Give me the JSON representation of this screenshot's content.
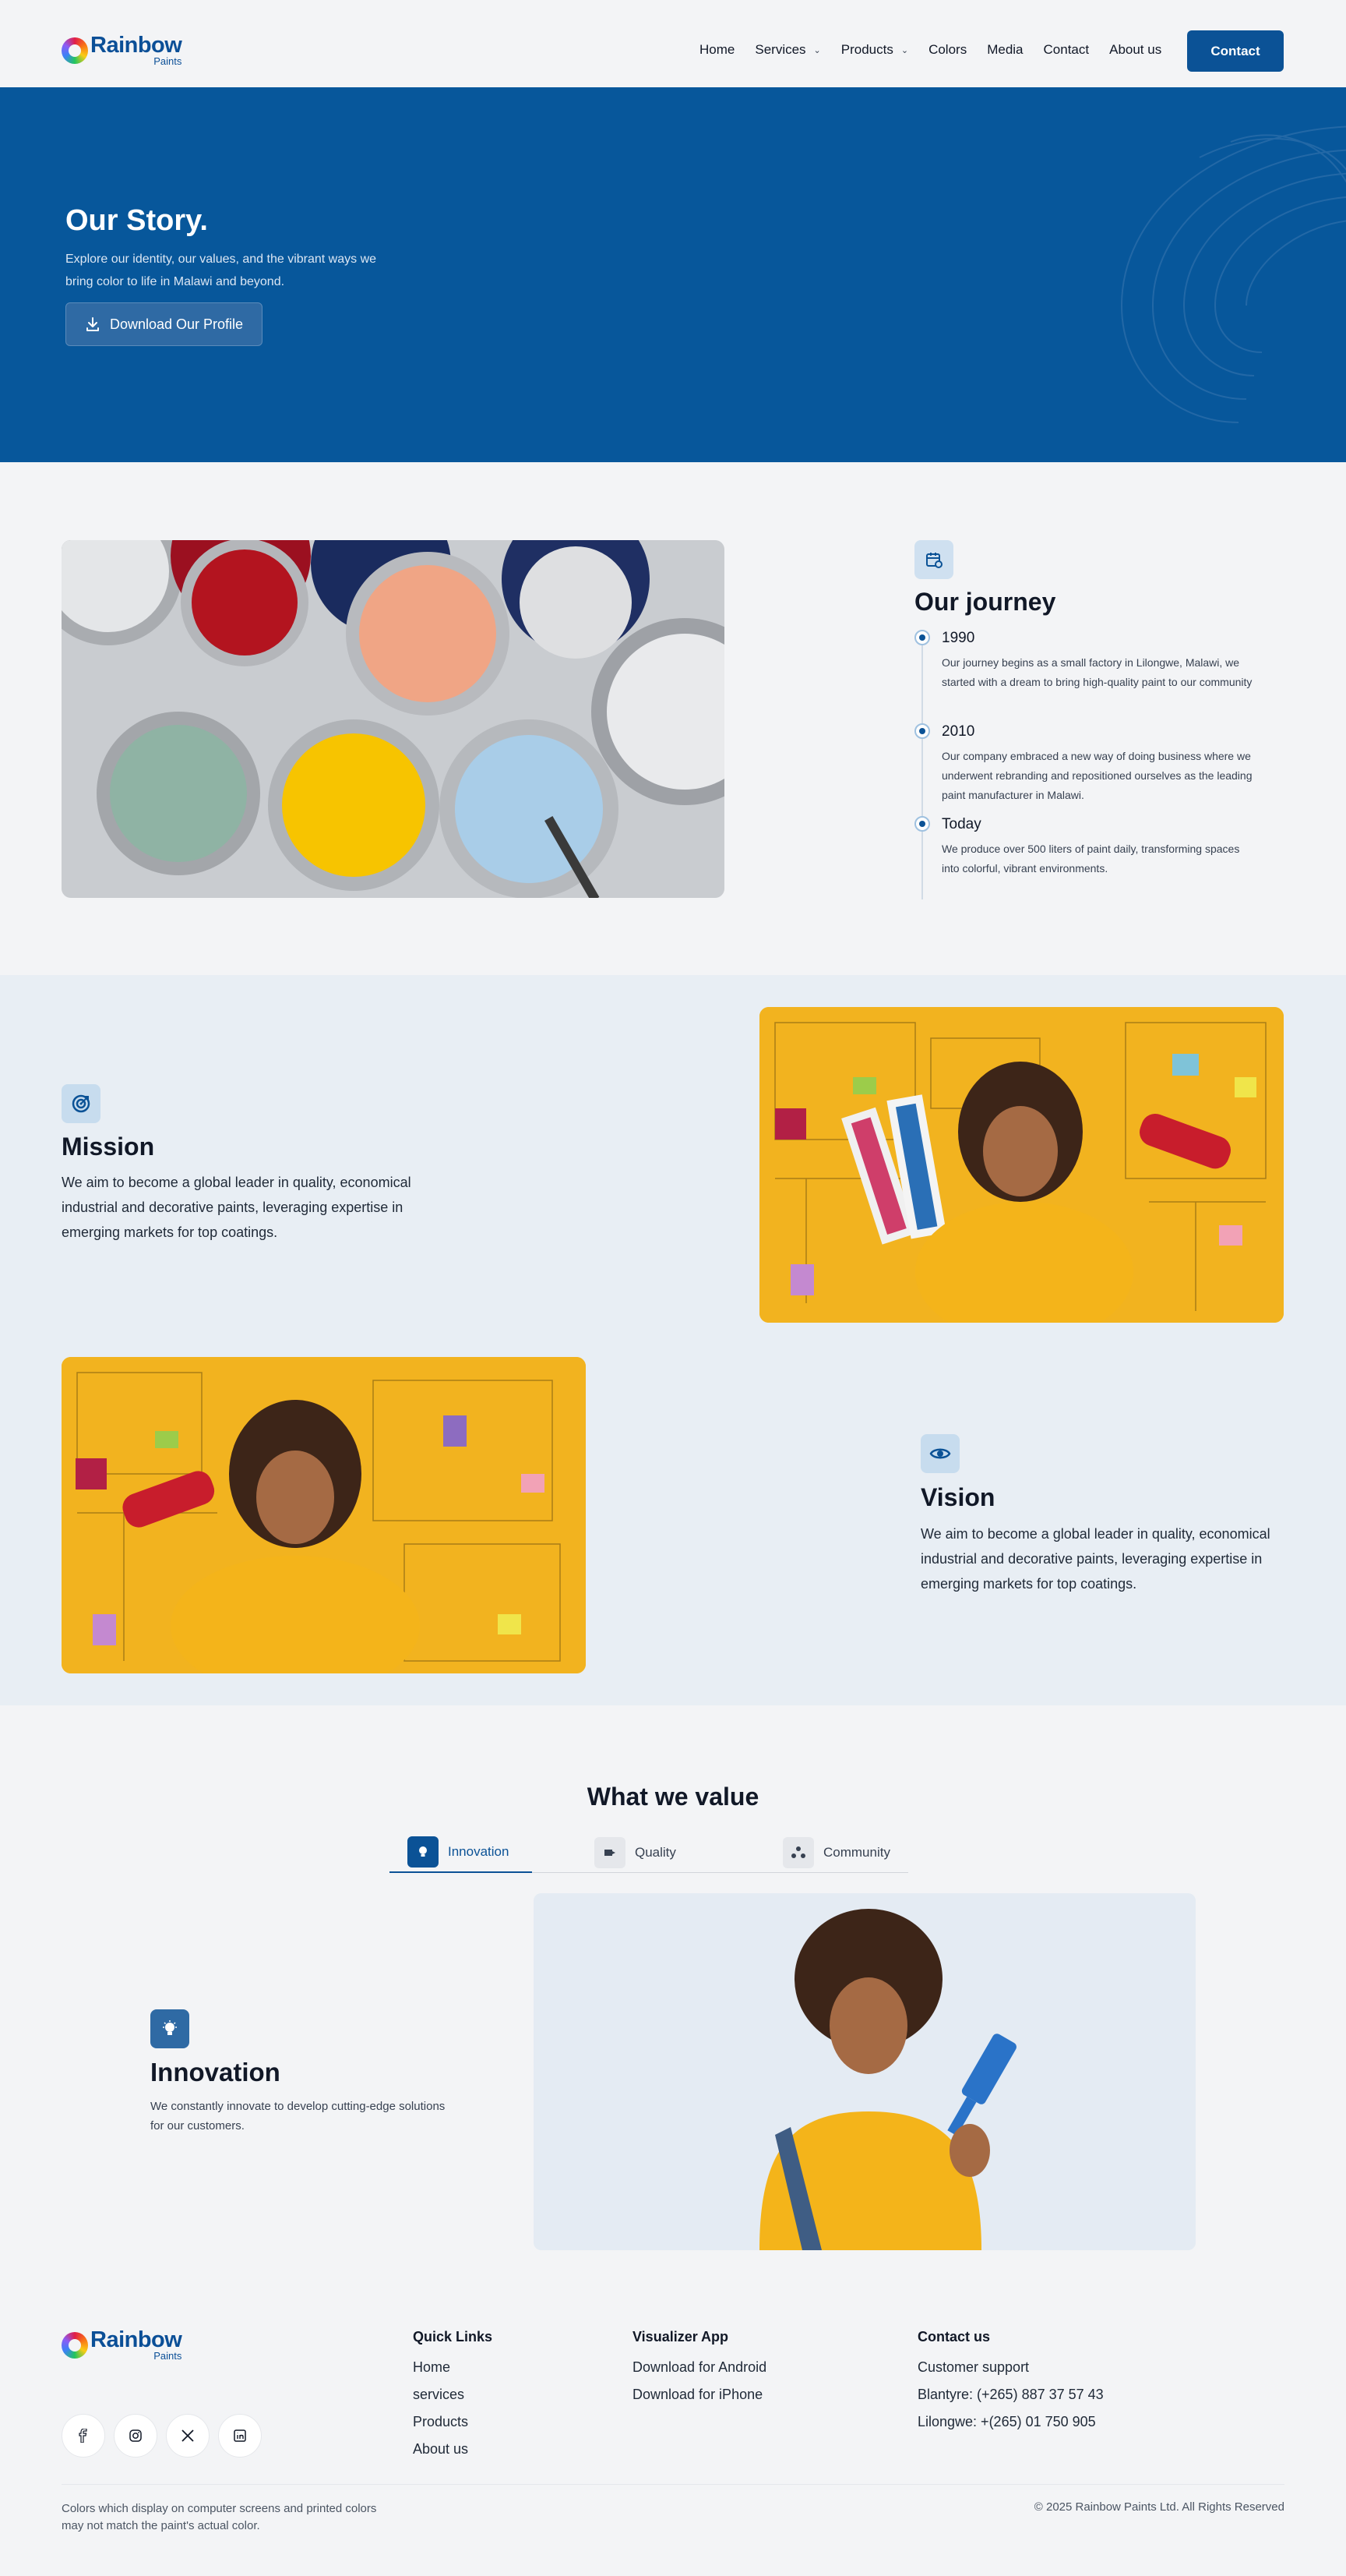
{
  "brand": {
    "name": "Rainbow",
    "sub": "Paints"
  },
  "nav": {
    "items": [
      {
        "label": "Home"
      },
      {
        "label": "Services"
      },
      {
        "label": "Products"
      },
      {
        "label": "Colors"
      },
      {
        "label": "Media"
      },
      {
        "label": "Contact"
      },
      {
        "label": "About us"
      }
    ],
    "cta": "Contact"
  },
  "hero": {
    "title": "Our Story.",
    "subtitle": "Explore our identity, our values, and the vibrant ways we bring color to life in Malawi and beyond.",
    "button": "Download  Our Profile"
  },
  "journey": {
    "title": "Our journey",
    "items": [
      {
        "year": "1990",
        "text": "Our journey begins as a small factory in Lilongwe, Malawi, we started with a dream to bring high-quality paint to our community"
      },
      {
        "year": "2010",
        "text": "Our company embraced a new way of doing business where we underwent rebranding and repositioned ourselves as the leading paint manufacturer in Malawi."
      },
      {
        "year": "Today",
        "text": "We produce over 500 liters of paint daily, transforming spaces into colorful, vibrant environments."
      }
    ]
  },
  "mission": {
    "title": "Mission",
    "text": "We aim to become a global leader in quality, economical industrial and decorative paints, leveraging expertise in emerging markets for top coatings."
  },
  "vision": {
    "title": "Vision",
    "text": "We aim to become a global leader in quality, economical industrial and decorative paints, leveraging expertise in emerging markets for top coatings."
  },
  "values": {
    "title": "What we value",
    "tabs": [
      {
        "label": "Innovation"
      },
      {
        "label": "Quality"
      },
      {
        "label": "Community"
      }
    ],
    "active": {
      "title": "Innovation",
      "text": "We constantly innovate to develop cutting-edge solutions for our customers."
    }
  },
  "footer": {
    "quick_links": {
      "heading": "Quick Links",
      "links": [
        "Home",
        "services",
        "Products",
        "About us"
      ]
    },
    "app": {
      "heading": "Visualizer App",
      "links": [
        "Download for Android",
        "Download for iPhone"
      ]
    },
    "contact": {
      "heading": "Contact us",
      "lines": [
        "Customer support",
        "Blantyre: (+265) 887 37 57 43",
        "Lilongwe: +(265) 01 750 905"
      ]
    },
    "note": "Colors which display on computer screens and printed colors may not match the paint's actual color.",
    "copyright": "© 2025 Rainbow Paints Ltd. All Rights Reserved"
  },
  "colors": {
    "primary": "#0b5296",
    "hero_bg": "#07579b",
    "band_bg": "#e8eef4",
    "accent_yellow": "#f4b524"
  }
}
